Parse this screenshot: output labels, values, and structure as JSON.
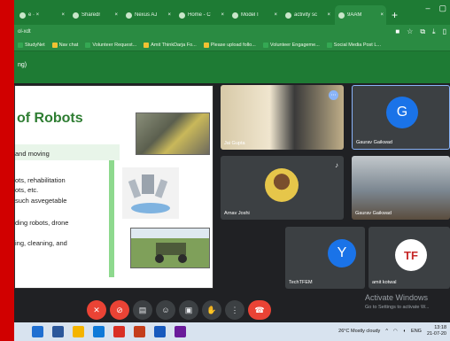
{
  "browser": {
    "tabs": [
      {
        "label": "e · ×"
      },
      {
        "label": "Sharedr"
      },
      {
        "label": "Nexus AJ"
      },
      {
        "label": "Home - C"
      },
      {
        "label": "Model I"
      },
      {
        "label": "activity sc"
      },
      {
        "label": "9AAM"
      }
    ],
    "address": "ol-xdt",
    "bookmarks": [
      "StudyNet",
      "Nav chat",
      "Volunteer Request...",
      "Amit ThinkDarja Fo...",
      "Please upload follo...",
      "Volunteer Engageme...",
      "Social Media Post L..."
    ]
  },
  "meet": {
    "header_text": "ng)"
  },
  "slide": {
    "title": "of Robots",
    "bullets": [
      "and moving",
      "ots, rehabilitation",
      "ots, etc.",
      "such asvegetable",
      "ding robots, drone",
      "ing, cleaning, and"
    ]
  },
  "participants": [
    {
      "name": "Jai Gupta"
    },
    {
      "name": "Gaurav Gaikwad",
      "initial": "G"
    },
    {
      "name": "Arnav Joshi"
    },
    {
      "name": "Gaurav Gaikwad"
    },
    {
      "name": "TechTFEM",
      "initial": "Y"
    },
    {
      "name": "amit kotwal",
      "initial": "TF"
    }
  ],
  "watermark": {
    "title": "Activate Windows",
    "subtitle": "Go to Settings to activate W..."
  },
  "taskbar": {
    "weather": "26°C  Mostly cloudy",
    "lang": "ENG",
    "time": "13:18",
    "date": "21-07-20"
  },
  "colors": {
    "frame": "#d10000",
    "browser_green": "#1e7b34",
    "end_call": "#ea4335",
    "avatar_blue": "#1a73e8"
  }
}
